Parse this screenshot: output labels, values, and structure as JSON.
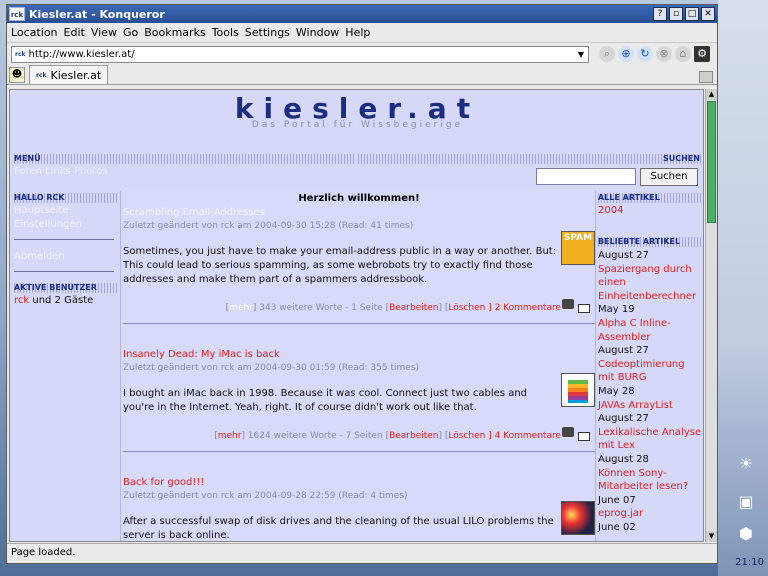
{
  "window": {
    "title": "Kiesler.at - Konqueror",
    "app_icon": "rck"
  },
  "menubar": {
    "items": [
      "Location",
      "Edit",
      "View",
      "Go",
      "Bookmarks",
      "Tools",
      "Settings",
      "Window",
      "Help"
    ]
  },
  "location": {
    "url": "http://www.kiesler.at/",
    "favicon": "rck"
  },
  "tabs": [
    {
      "label": "Kiesler.at",
      "favicon": "rck"
    }
  ],
  "status": "Page loaded.",
  "clock": "21:10",
  "page": {
    "logo": "kiesler.at",
    "tagline": "Das Portal für Wissbegierige",
    "menu_head": "MENÜ",
    "menu_links": "Foren Links Photos",
    "search_head": "SUCHEN",
    "search_button": "Suchen",
    "left": {
      "hello_head": "HALLO RCK",
      "links": [
        "Hauptseite",
        "Einstellungen"
      ],
      "logout": "Abmelden",
      "active_head": "AKTIVE BENUTZER",
      "active_user": "rck",
      "active_rest": " und 2 Gäste"
    },
    "welcome": "Herzlich willkommen!",
    "articles": [
      {
        "title": "Scrambling Email-Addresses",
        "meta": "Zuletzt geändert von rck am 2004-09-30 15:28 (Read: 41 times)",
        "body": "Sometimes, you just have to make your email-address public in a way or another. But: This could lead to serious spamming, as some webrobots try to exactly find those addresses and make them part of a spammers addressbook.",
        "footer_pre": "[",
        "more": "mehr",
        "footer_mid": "] 343 weitere Worte - 1 Seite [",
        "edit": "Bearbeiten",
        "footer_sep": "] [",
        "delete": "Löschen",
        "comments": " ] 2 Kommentare",
        "image_label": "SPAM"
      },
      {
        "title": "Insanely Dead: My iMac is back",
        "meta": "Zuletzt geändert von rck am 2004-09-30 01:59 (Read: 355 times)",
        "body": "I bought an iMac back in 1998. Because it was cool. Connect just two cables and you're in the Internet. Yeah, right. It of course didn't work out like that.",
        "footer_pre": "[",
        "more": "mehr",
        "footer_mid": "] 1624 weitere Worte - 7 Seiten [",
        "edit": "Bearbeiten",
        "footer_sep": "] [",
        "delete": "Löschen",
        "comments": " ] 4 Kommentare",
        "image_label": "apple-logo"
      },
      {
        "title": "Back for good!!!",
        "meta": "Zuletzt geändert von rck am 2004-09-28 22:59 (Read: 4 times)",
        "body": "After a successful swap of disk drives and the cleaning of the usual LILO problems the server is back online.",
        "image_label": "fireworks"
      }
    ],
    "right": {
      "all_head": "ALLE ARTIKEL",
      "year": "2004",
      "popular_head": "BELIEBTE ARTIKEL",
      "popular": [
        {
          "date": "August 27",
          "title": "Spaziergang durch einen Einheitenberechner"
        },
        {
          "date": "May 19",
          "title": "Alpha C Inline-Assembler"
        },
        {
          "date": "August 27",
          "title": "Codeoptimierung mit BURG"
        },
        {
          "date": "May 28",
          "title": "JAVAs ArrayList"
        },
        {
          "date": "August 27",
          "title": "Lexikalische Analyse mit Lex"
        },
        {
          "date": "August 28",
          "title": "Können Sony-Mitarbeiter lesen?"
        },
        {
          "date": "June 07",
          "title": "eprog.jar"
        },
        {
          "date": "June 02",
          "title": ""
        }
      ]
    }
  },
  "colors": {
    "title_bar": "#2a4e93",
    "link_red": "#e02020",
    "page_bg": "#d6d8f7"
  }
}
